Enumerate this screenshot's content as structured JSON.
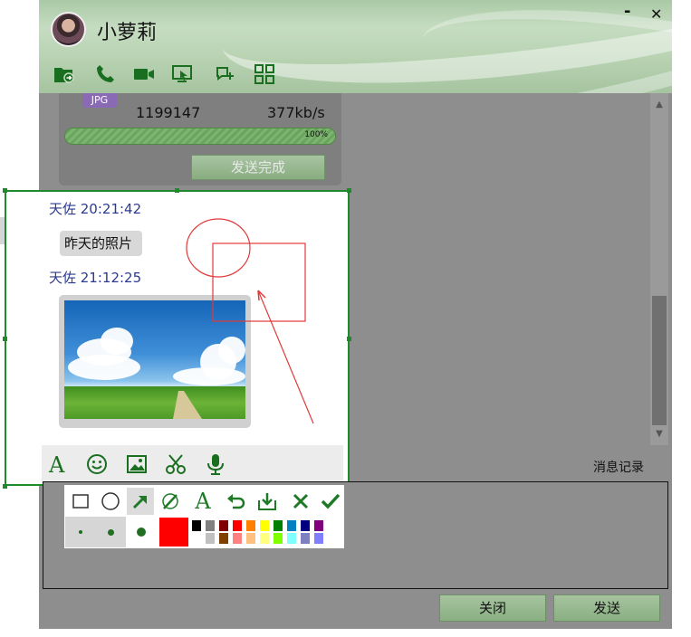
{
  "window": {
    "title": "小萝莉",
    "minimize_label": "-",
    "close_label": "✕"
  },
  "toolbar": {
    "icons": [
      "file-transfer-icon",
      "phone-icon",
      "video-icon",
      "screen-share-icon",
      "chat-add-icon",
      "apps-grid-icon"
    ]
  },
  "file_transfer": {
    "type_badge": "JPG",
    "size": "1199147",
    "rate": "377kb/s",
    "progress_percent": 100,
    "progress_label": "100%",
    "status_button": "发送完成"
  },
  "messages": [
    {
      "sender_time": "天佐 20:21:42",
      "text": "昨天的照片"
    },
    {
      "sender_time": "天佐 21:12:25",
      "image": "landscape-photo"
    }
  ],
  "input_toolbar": {
    "icons": [
      "font-icon",
      "emoji-icon",
      "image-icon",
      "scissors-icon",
      "microphone-icon"
    ],
    "history_label": "消息记录"
  },
  "drawing_tools": {
    "tools": [
      "rectangle-tool",
      "ellipse-tool",
      "arrow-tool",
      "brush-tool",
      "text-tool",
      "undo-tool",
      "save-tool",
      "cancel-tool",
      "confirm-tool"
    ],
    "text_tool_label": "A",
    "selected_tool": "arrow-tool",
    "sizes": [
      "small",
      "medium",
      "large"
    ],
    "current_color": "#ff0000",
    "palette_top": [
      "#000000",
      "#808080",
      "#800000",
      "#ff0000",
      "#ff8000",
      "#ffff00",
      "#008000",
      "#0080c0",
      "#000080",
      "#800080"
    ],
    "palette_bottom": [
      "#ffffff",
      "#c0c0c0",
      "#804000",
      "#ff8080",
      "#ffc080",
      "#ffff80",
      "#80ff00",
      "#80ffff",
      "#8080c0",
      "#8080ff"
    ],
    "accent": "#1f8a2c"
  },
  "actions": {
    "close": "关闭",
    "send": "发送"
  }
}
